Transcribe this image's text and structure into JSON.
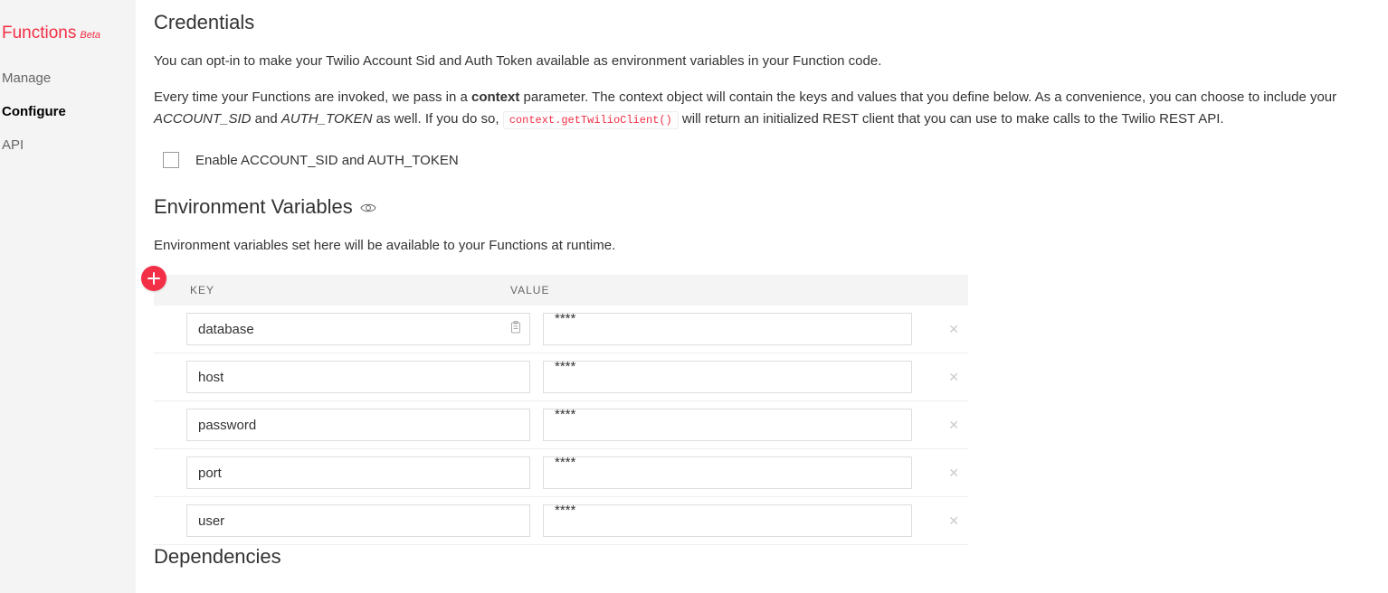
{
  "sidebar": {
    "title": "Functions",
    "beta": "Beta",
    "items": [
      {
        "label": "Manage",
        "active": false
      },
      {
        "label": "Configure",
        "active": true
      },
      {
        "label": "API",
        "active": false
      }
    ]
  },
  "credentials": {
    "heading": "Credentials",
    "desc1": "You can opt-in to make your Twilio Account Sid and Auth Token available as environment variables in your Function code.",
    "desc2_pre": "Every time your Functions are invoked, we pass in a ",
    "desc2_bold": "context",
    "desc2_mid": " parameter. The context object will contain the keys and values that you define below. As a convenience, you can choose to include your ",
    "desc2_italic1": "ACCOUNT_SID",
    "desc2_and": " and ",
    "desc2_italic2": "AUTH_TOKEN",
    "desc2_post1": " as well. If you do so, ",
    "desc2_code": "context.getTwilioClient()",
    "desc2_post2": " will return an initialized REST client that you can use to make calls to the Twilio REST API.",
    "checkbox_label": "Enable ACCOUNT_SID and AUTH_TOKEN"
  },
  "env": {
    "heading": "Environment Variables",
    "desc": "Environment variables set here will be available to your Functions at runtime.",
    "headers": {
      "key": "KEY",
      "value": "VALUE"
    },
    "rows": [
      {
        "key": "database",
        "value": "****",
        "has_clipboard": true
      },
      {
        "key": "host",
        "value": "****",
        "has_clipboard": false
      },
      {
        "key": "password",
        "value": "****",
        "has_clipboard": false
      },
      {
        "key": "port",
        "value": "****",
        "has_clipboard": false
      },
      {
        "key": "user",
        "value": "****",
        "has_clipboard": false
      }
    ]
  },
  "deps": {
    "heading": "Dependencies"
  }
}
